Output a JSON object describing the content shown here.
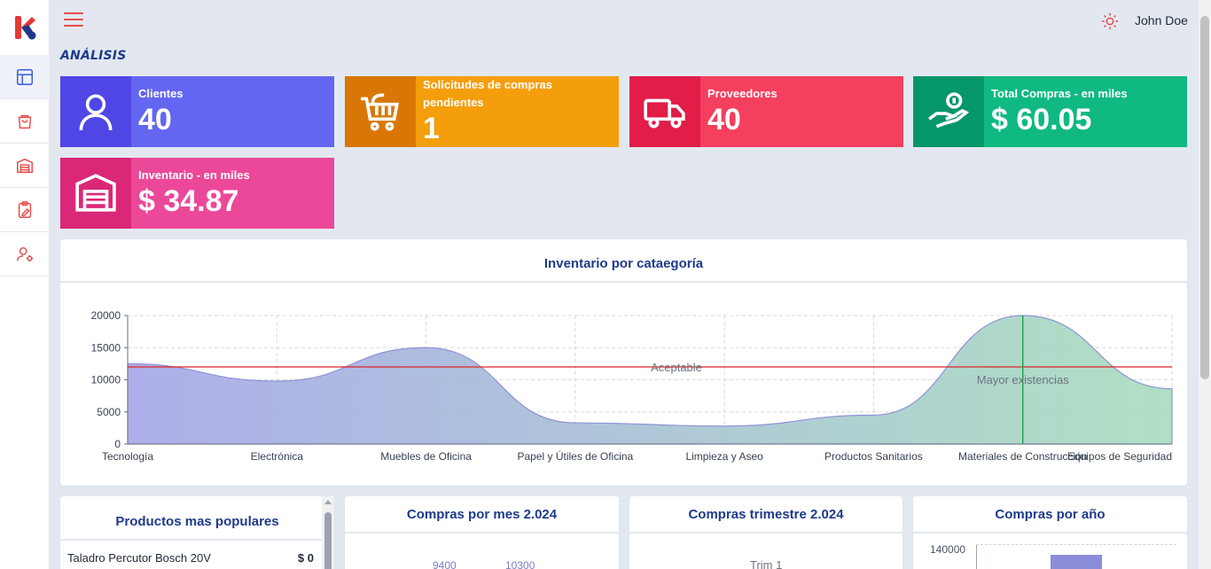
{
  "header": {
    "user_name": "John Doe"
  },
  "section_title": "ANÁLISIS",
  "sidebar": {
    "items": [
      {
        "name": "dashboard",
        "icon": "layout-icon",
        "active": true
      },
      {
        "name": "purchases",
        "icon": "shopping-bag-icon",
        "active": false
      },
      {
        "name": "inventory",
        "icon": "warehouse-icon",
        "active": false
      },
      {
        "name": "requests",
        "icon": "clipboard-icon",
        "active": false
      },
      {
        "name": "user-settings",
        "icon": "user-gear-icon",
        "active": false
      }
    ]
  },
  "cards": [
    {
      "label": "Clientes",
      "value": "40",
      "icon": "user-icon",
      "color": "#6366f1",
      "icon_bg": "#4f46e5"
    },
    {
      "label": "Solicitudes de compras pendientes",
      "value": "1",
      "icon": "cart-icon",
      "color": "#f59e0b",
      "icon_bg": "#d97706"
    },
    {
      "label": "Proveedores",
      "value": "40",
      "icon": "truck-icon",
      "color": "#f43f5e",
      "icon_bg": "#e11d48"
    },
    {
      "label": "Total Compras - en miles",
      "value": "$ 60.05",
      "icon": "hand-coins-icon",
      "color": "#10b981",
      "icon_bg": "#059669"
    },
    {
      "label": "Inventario - en miles",
      "value": "$ 34.87",
      "icon": "warehouse-icon",
      "color": "#ec4899",
      "icon_bg": "#db2777"
    }
  ],
  "chart_data": {
    "type": "area",
    "title": "Inventario por cataegoría",
    "categories": [
      "Tecnología",
      "Electrónica",
      "Muebles de Oficina",
      "Papel y Útiles de Oficina",
      "Limpieza y Aseo",
      "Productos Sanitarios",
      "Materiales de Construcción",
      "Equipos de Seguridad"
    ],
    "values": [
      12500,
      9800,
      15000,
      3300,
      2800,
      4500,
      20000,
      8600
    ],
    "y_ticks": [
      0,
      5000,
      10000,
      15000,
      20000
    ],
    "ylim": [
      0,
      20000
    ],
    "grid": true,
    "annotations": [
      {
        "type": "horizontal-line",
        "value": 12000,
        "label": "Aceptable",
        "color": "#dc2626"
      },
      {
        "type": "vertical-line",
        "category": "Materiales de Construcción",
        "label": "Mayor existencias",
        "color": "#16a34a"
      }
    ]
  },
  "bottom_panels": {
    "popular": {
      "title": "Productos mas populares",
      "items": [
        {
          "name": "Taladro Percutor Bosch 20V",
          "price": "$ 0"
        }
      ]
    },
    "monthly": {
      "title": "Compras por mes 2.024",
      "labels": [
        "9400",
        "10300"
      ]
    },
    "quarter": {
      "title": "Compras trimestre 2.024",
      "labels": [
        "Trim 1"
      ]
    },
    "yearly": {
      "title": "Compras por año",
      "labels": [
        "140000"
      ]
    }
  }
}
